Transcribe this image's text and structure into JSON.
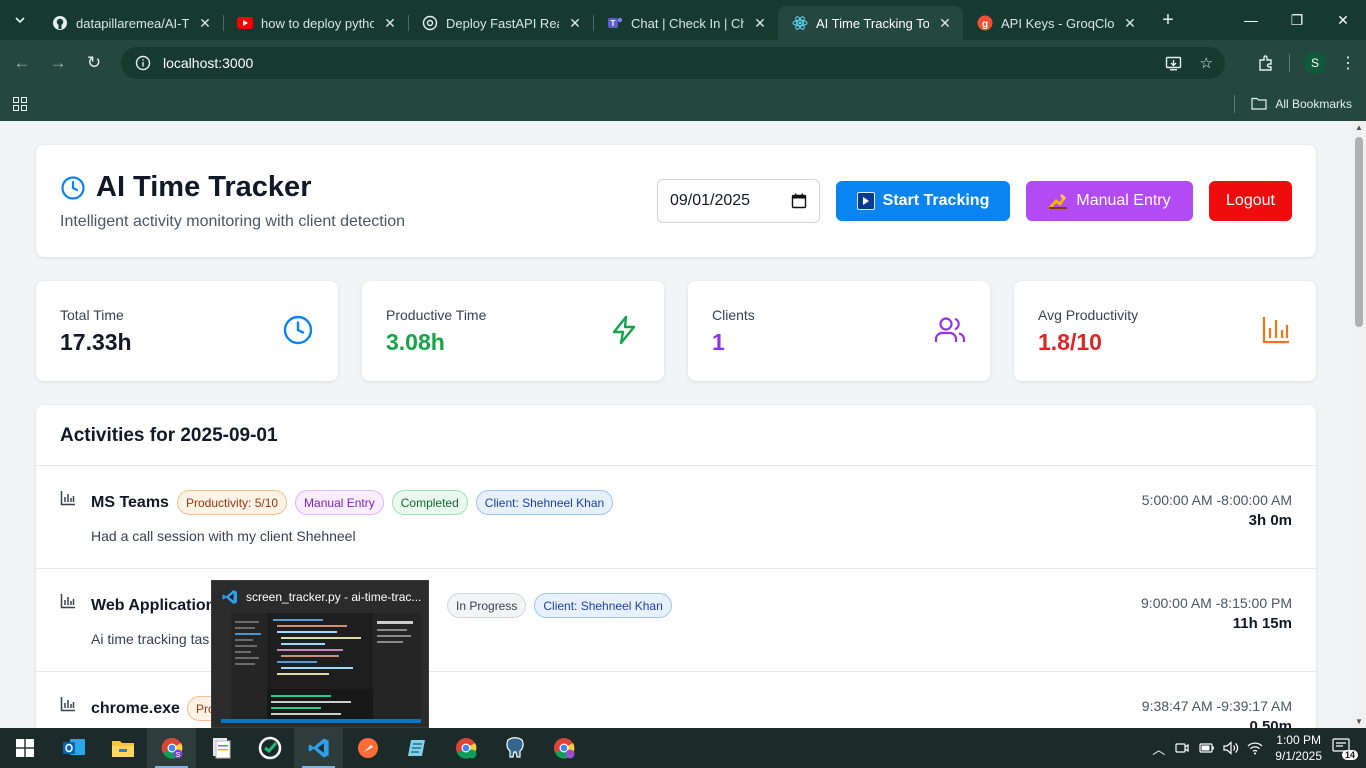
{
  "browser": {
    "tabs": [
      {
        "title": "datapillaremea/AI-Tim",
        "icon": "github-icon",
        "active": false
      },
      {
        "title": "how to deploy pythor",
        "icon": "youtube-icon",
        "active": false
      },
      {
        "title": "Deploy FastAPI React",
        "icon": "openai-icon",
        "active": false
      },
      {
        "title": "Chat | Check In | Che",
        "icon": "teams-icon",
        "active": false
      },
      {
        "title": "AI Time Tracking Tool",
        "icon": "react-icon",
        "active": true
      },
      {
        "title": "API Keys - GroqCloud",
        "icon": "groq-icon",
        "active": false
      }
    ],
    "url": "localhost:3000",
    "bookmarks_label": "All Bookmarks",
    "profile_initial": "S"
  },
  "header": {
    "title": "AI Time Tracker",
    "subtitle": "Intelligent activity monitoring with client detection",
    "date_value": "09/01/2025",
    "start_label": "Start Tracking",
    "manual_label": "Manual Entry",
    "logout_label": "Logout"
  },
  "stats": [
    {
      "label": "Total Time",
      "value": "17.33h",
      "color": "#111827",
      "icon": "clock-icon",
      "icon_color": "#0a84f0"
    },
    {
      "label": "Productive Time",
      "value": "3.08h",
      "color": "#16a34a",
      "icon": "lightning-icon",
      "icon_color": "#16a34a"
    },
    {
      "label": "Clients",
      "value": "1",
      "color": "#9333ea",
      "icon": "users-icon",
      "icon_color": "#9333ea"
    },
    {
      "label": "Avg Productivity",
      "value": "1.8/10",
      "color": "#dc2626",
      "icon": "bar-chart-icon",
      "icon_color": "#f97316"
    }
  ],
  "activities": {
    "title": "Activities for 2025-09-01",
    "rows": [
      {
        "name": "MS Teams",
        "tags": [
          "Productivity: 5/10",
          "Manual Entry",
          "Completed",
          "Client: Shehneel Khan"
        ],
        "description": "Had a call session with my client Shehneel",
        "time_range": "5:00:00 AM -8:00:00 AM",
        "duration": "3h 0m"
      },
      {
        "name": "Web Application",
        "tags": [
          "In Progress",
          "Client: Shehneel Khan"
        ],
        "description": "Ai time tracking tas",
        "time_range": "9:00:00 AM -8:15:00 PM",
        "duration": "11h 15m"
      },
      {
        "name": "chrome.exe",
        "tags": [
          "Pro"
        ],
        "description": "",
        "time_range": "9:38:47 AM -9:39:17 AM",
        "duration": "0.50m"
      }
    ]
  },
  "preview": {
    "title": "screen_tracker.py - ai-time-trac..."
  },
  "taskbar": {
    "time": "1:00 PM",
    "date": "9/1/2025",
    "notif_count": "14"
  },
  "colors": {
    "accent_blue": "#0a84f0",
    "accent_purple": "#b24bf3",
    "danger": "#ee0c0c"
  }
}
